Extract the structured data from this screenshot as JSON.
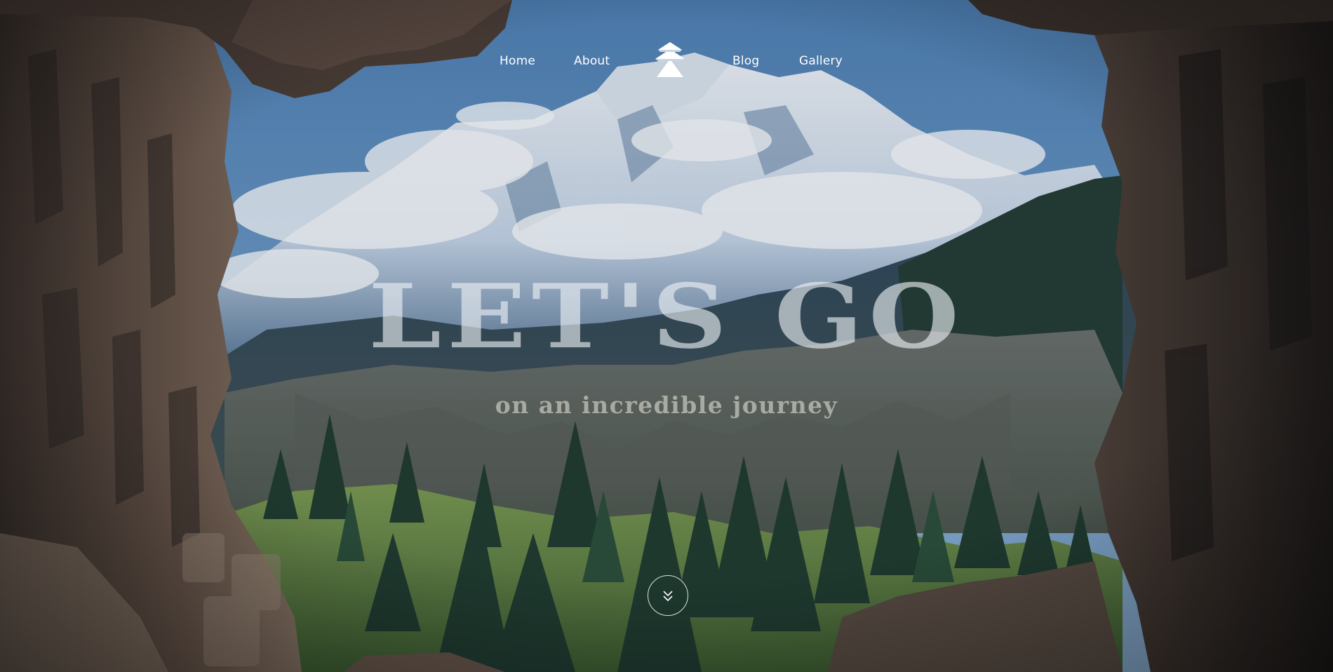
{
  "nav": {
    "items": [
      {
        "label": "Home"
      },
      {
        "label": "About"
      },
      {
        "label": "Blog"
      },
      {
        "label": "Gallery"
      }
    ],
    "logo": {
      "icon": "pine-tree-logo-icon"
    }
  },
  "hero": {
    "headline": "LET'S GO",
    "subheadline": "on an incredible journey",
    "scroll_icon": "double-chevron-down-icon"
  },
  "colors": {
    "sky": "#5e8fc0",
    "snow": "#eef2f6",
    "forest": "#1f3a2a",
    "rock": "#4a3b30",
    "headline": "#e6ebef"
  }
}
